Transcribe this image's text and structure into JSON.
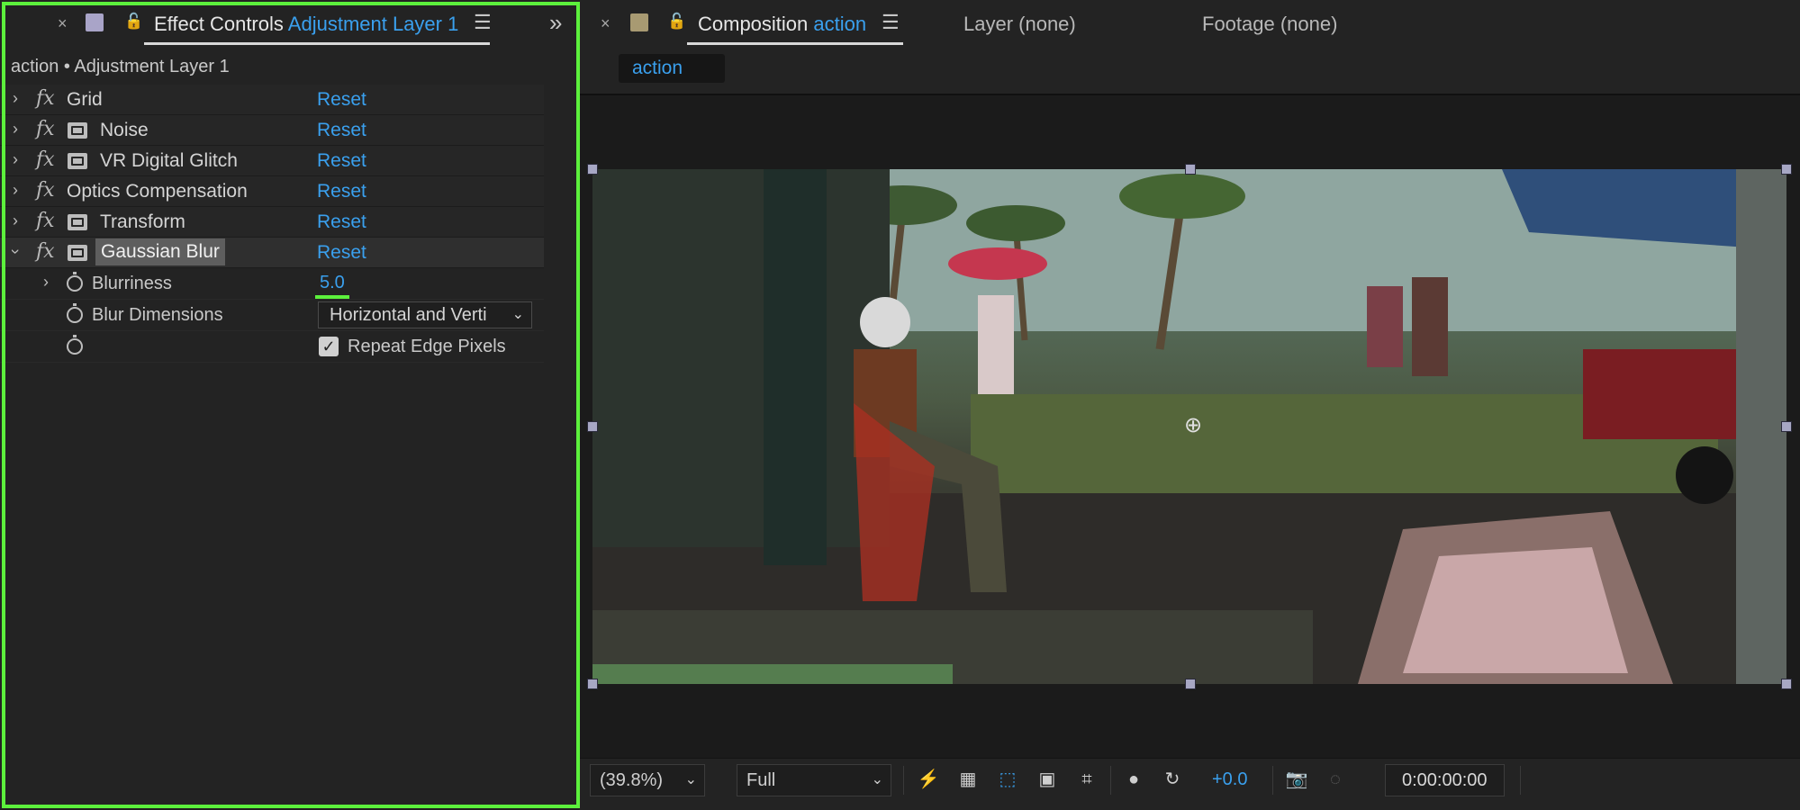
{
  "effect_controls": {
    "close_glyph": "×",
    "swatch_color": "#a9a4c8",
    "tab_label": "Effect Controls",
    "tab_target": "Adjustment Layer 1",
    "subtitle": "action • Adjustment Layer 1",
    "effects": [
      {
        "name": "Grid",
        "has_icon": false,
        "reset": "Reset"
      },
      {
        "name": "Noise",
        "has_icon": true,
        "reset": "Reset"
      },
      {
        "name": "VR Digital Glitch",
        "has_icon": true,
        "reset": "Reset"
      },
      {
        "name": "Optics Compensation",
        "has_icon": false,
        "reset": "Reset"
      },
      {
        "name": "Transform",
        "has_icon": true,
        "reset": "Reset"
      },
      {
        "name": "Gaussian Blur",
        "has_icon": true,
        "reset": "Reset"
      }
    ],
    "blurriness": {
      "label": "Blurriness",
      "value": "5.0"
    },
    "blur_dimensions": {
      "label": "Blur Dimensions",
      "value": "Horizontal and Verti"
    },
    "repeat_edge_pixels": {
      "label": "Repeat Edge Pixels",
      "checked": true
    }
  },
  "composition": {
    "close_glyph": "×",
    "swatch_color": "#a89a72",
    "tab_label": "Composition",
    "tab_target": "action",
    "layer_tab": "Layer (none)",
    "footage_tab": "Footage (none)",
    "flowchart_chip": "action"
  },
  "viewer_controls": {
    "magnification": "(39.8%)",
    "resolution": "Full",
    "exposure": "+0.0",
    "timecode": "0:00:00:00"
  },
  "colors": {
    "accent": "#3aa0ee",
    "highlight_border": "#5cf03c"
  }
}
